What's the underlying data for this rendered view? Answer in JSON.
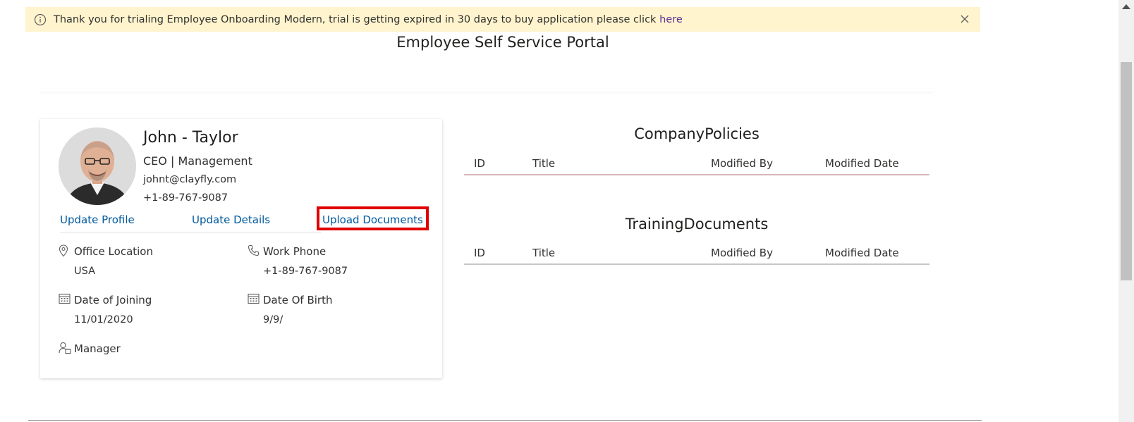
{
  "banner": {
    "message": "Thank you for trialing Employee Onboarding Modern, trial is getting expired in 30 days to buy application please click ",
    "link_label": "here",
    "icons": {
      "info": "info-icon",
      "close": "close-icon"
    }
  },
  "page": {
    "title": "Employee Self Service Portal"
  },
  "profile": {
    "name": "John - Taylor",
    "role": "CEO | Management",
    "email": "johnt@clayfly.com",
    "phone": "+1-89-767-9087",
    "actions": {
      "update_profile": "Update Profile",
      "update_details": "Update Details",
      "upload_documents": "Upload Documents"
    },
    "fields": {
      "office_location": {
        "label": "Office Location",
        "value": "USA",
        "icon": "location-pin-icon"
      },
      "work_phone": {
        "label": "Work Phone",
        "value": "+1-89-767-9087",
        "icon": "phone-icon"
      },
      "date_of_joining": {
        "label": "Date of Joining",
        "value": "11/01/2020",
        "icon": "calendar-icon"
      },
      "date_of_birth": {
        "label": "Date Of Birth",
        "value": "9/9/",
        "icon": "calendar-icon"
      },
      "manager": {
        "label": "Manager",
        "value": "",
        "icon": "manager-icon"
      }
    }
  },
  "company_policies": {
    "title": "CompanyPolicies",
    "columns": [
      "ID",
      "Title",
      "Modified By",
      "Modified Date"
    ]
  },
  "training_documents": {
    "title": "TrainingDocuments",
    "columns": [
      "ID",
      "Title",
      "Modified By",
      "Modified Date"
    ]
  },
  "colors": {
    "banner_bg": "#fff4ce",
    "link": "#005a9e",
    "highlight_border": "#e00000"
  }
}
